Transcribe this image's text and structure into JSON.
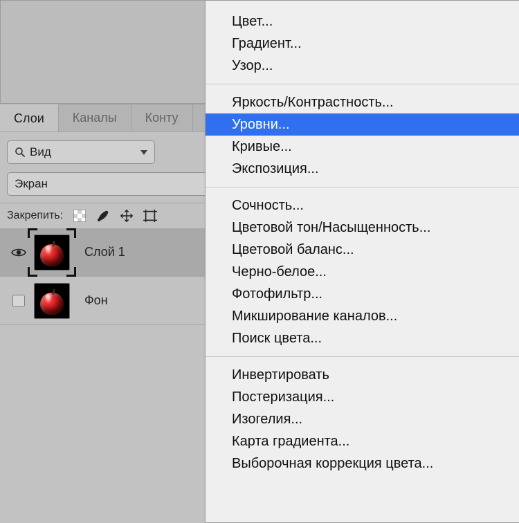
{
  "thumb_tooltip": "image",
  "tabs": {
    "layers": "Слои",
    "channels": "Каналы",
    "paths": "Конту"
  },
  "kind_select": {
    "label": "Вид"
  },
  "mode_select": {
    "label": "Экран"
  },
  "lock": {
    "label": "Закрепить:"
  },
  "layers": [
    {
      "name": "Слой 1",
      "visible": true,
      "selected": true
    },
    {
      "name": "Фон",
      "visible": false,
      "selected": false
    }
  ],
  "menu": {
    "group1": [
      "Цвет...",
      "Градиент...",
      "Узор..."
    ],
    "group2": [
      "Яркость/Контрастность...",
      "Уровни...",
      "Кривые...",
      "Экспозиция..."
    ],
    "group2_highlight_index": 1,
    "group3": [
      "Сочность...",
      "Цветовой тон/Насыщенность...",
      "Цветовой баланс...",
      "Черно-белое...",
      "Фотофильтр...",
      "Микширование каналов...",
      "Поиск цвета..."
    ],
    "group4": [
      "Инвертировать",
      "Постеризация...",
      "Изогелия...",
      "Карта градиента...",
      "Выборочная коррекция цвета..."
    ]
  }
}
